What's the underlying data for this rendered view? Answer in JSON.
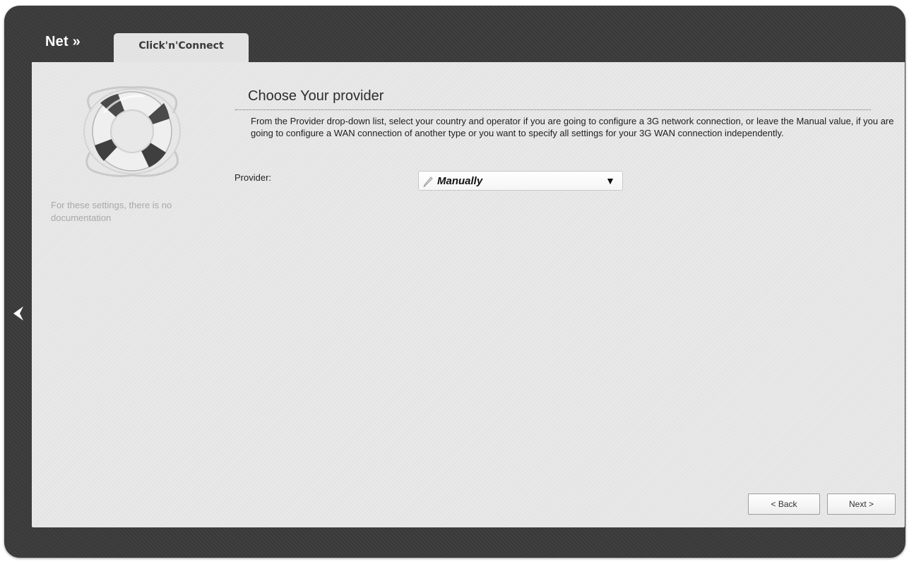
{
  "header": {
    "breadcrumb": "Net »",
    "tab_label": "Click'n'Connect"
  },
  "sidebar": {
    "icon": "lifebuoy-icon",
    "note": "For these settings, there is no documentation"
  },
  "main": {
    "title": "Choose Your provider",
    "description": "From the Provider drop-down list, select your country and operator if you are going to configure a 3G network connection, or leave the Manual value, if you are going to configure a WAN connection of another type or you want to specify all settings for your 3G WAN connection independently.",
    "provider_label": "Provider:",
    "provider_value": "Manually",
    "provider_caret": "▼"
  },
  "buttons": {
    "back": "< Back",
    "next": "Next >"
  },
  "nav": {
    "back_arrow_icon": "chevron-left-icon"
  },
  "colors": {
    "frame": "#3b3b3b",
    "panel": "#e8e8e8",
    "tab": "#e3e3e3",
    "text": "#1e1e1e",
    "muted": "#a8a8a8"
  }
}
